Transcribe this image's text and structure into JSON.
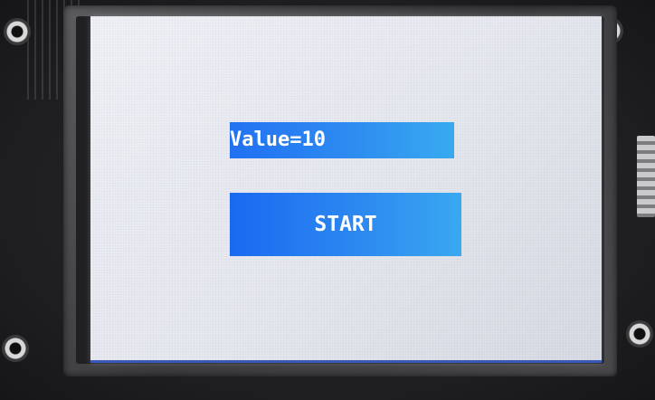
{
  "display": {
    "value_label": "Value=10",
    "start_button_label": "START"
  },
  "colors": {
    "widget_blue": "#2c88f0",
    "screen_background": "#e8eaf2",
    "text": "#ffffff"
  }
}
